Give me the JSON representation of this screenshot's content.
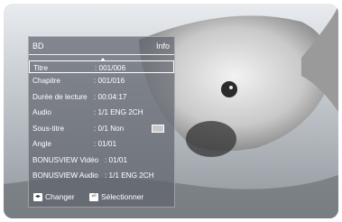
{
  "panel": {
    "title": "BD",
    "info_label": "Info",
    "rows": [
      {
        "label": "Titre",
        "value": ": 001/006"
      },
      {
        "label": "Chapitre",
        "value": ": 001/016"
      },
      {
        "label": "Durée de lecture",
        "value": ": 00:04:17"
      },
      {
        "label": "Audio",
        "value": ": 1/1 ENG 2CH"
      },
      {
        "label": "Sous-titre",
        "value": ": 0/1 Non"
      },
      {
        "label": "Angle",
        "value": ": 01/01"
      },
      {
        "label": "BONUSVIEW Vidéo",
        "value": ": 01/01"
      },
      {
        "label": "BONUSVIEW Audio",
        "value": ": 1/1 ENG 2CH"
      }
    ],
    "selected_index": 0
  },
  "footer": {
    "change_label": "Changer",
    "select_label": "Sélectionner"
  }
}
